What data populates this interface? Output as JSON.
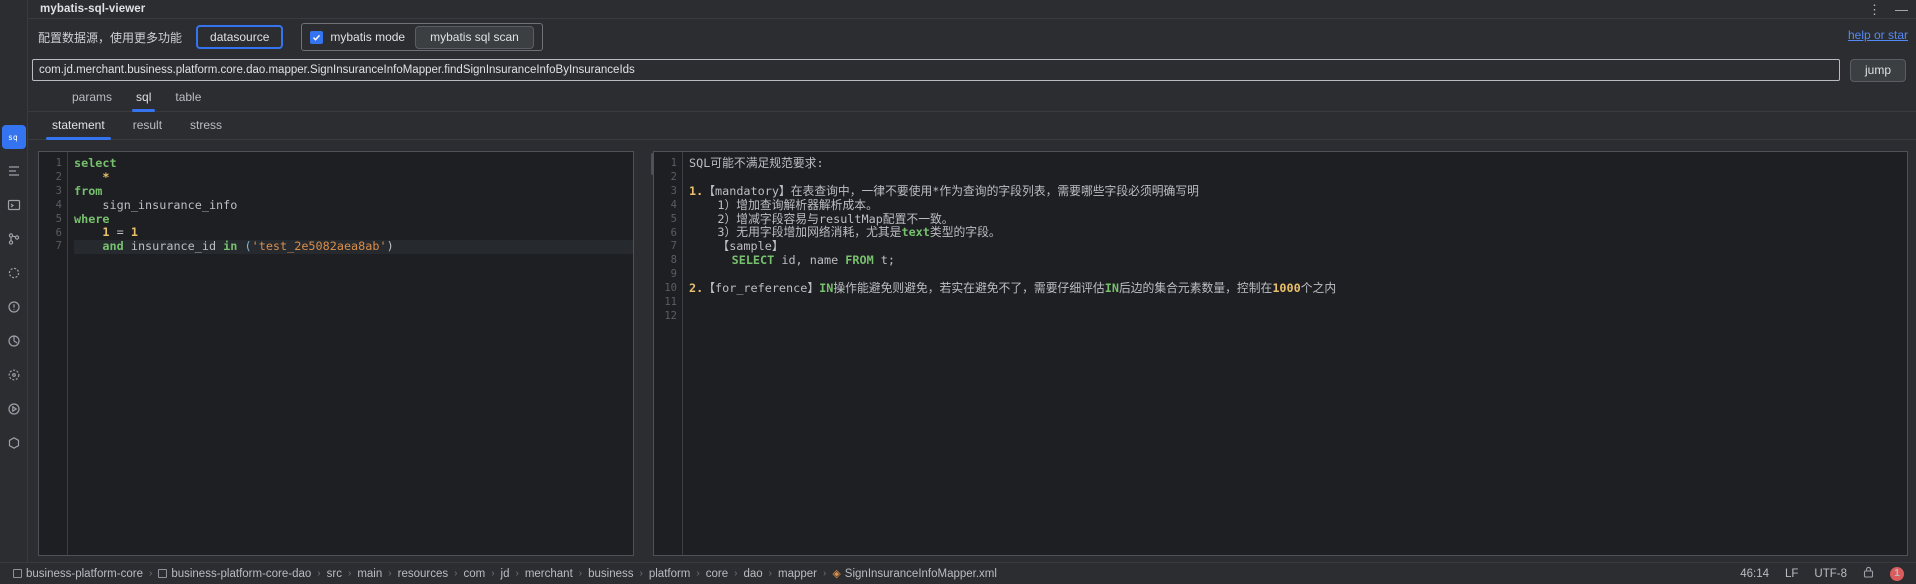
{
  "window": {
    "title": "mybatis-sql-viewer",
    "more_icon": "more-vertical-icon",
    "minimize_icon": "minimize-icon"
  },
  "toolbar": {
    "hint": "配置数据源，使用更多功能",
    "datasource_button": "datasource",
    "mybatis_mode_label": "mybatis mode",
    "mybatis_mode_checked": true,
    "mybatis_sql_scan_button": "mybatis sql scan",
    "help_link": "help or star"
  },
  "search": {
    "value": "com.jd.merchant.business.platform.core.dao.mapper.SignInsuranceInfoMapper.findSignInsuranceInfoByInsuranceIds",
    "placeholder": "",
    "jump_button": "jump"
  },
  "main_tabs": [
    {
      "label": "params",
      "active": false
    },
    {
      "label": "sql",
      "active": true
    },
    {
      "label": "table",
      "active": false
    }
  ],
  "sub_tabs": [
    {
      "label": "statement",
      "active": true
    },
    {
      "label": "result",
      "active": false
    },
    {
      "label": "stress",
      "active": false
    }
  ],
  "rail_icons": [
    {
      "name": "sql-icon",
      "glyph": "sq",
      "active": true
    },
    {
      "name": "structure-icon",
      "glyph": "⫴",
      "active": false
    },
    {
      "name": "terminal-icon",
      "glyph": "▣",
      "active": false
    },
    {
      "name": "branch-icon",
      "glyph": "⑂",
      "active": false
    },
    {
      "name": "debug-icon",
      "glyph": "⬡",
      "active": false
    },
    {
      "name": "problems-icon",
      "glyph": "!",
      "active": false
    },
    {
      "name": "profiler-icon",
      "glyph": "◔",
      "active": false
    },
    {
      "name": "services-icon",
      "glyph": "⬢",
      "active": false
    },
    {
      "name": "run-icon",
      "glyph": "▷",
      "active": false
    },
    {
      "name": "plugins-icon",
      "glyph": "⬣",
      "active": false
    }
  ],
  "sql_editor": {
    "line_numbers": [
      "1",
      "2",
      "3",
      "4",
      "5",
      "6",
      "7"
    ],
    "lines": [
      [
        {
          "t": "select",
          "c": "kw"
        }
      ],
      [
        {
          "t": "    ",
          "c": "plain"
        },
        {
          "t": "*",
          "c": "num"
        }
      ],
      [
        {
          "t": "from",
          "c": "kw"
        }
      ],
      [
        {
          "t": "    sign_insurance_info",
          "c": "plain"
        }
      ],
      [
        {
          "t": "where",
          "c": "kw"
        }
      ],
      [
        {
          "t": "    ",
          "c": "plain"
        },
        {
          "t": "1",
          "c": "num"
        },
        {
          "t": " = ",
          "c": "plain"
        },
        {
          "t": "1",
          "c": "num"
        }
      ],
      [
        {
          "t": "    ",
          "c": "plain"
        },
        {
          "t": "and",
          "c": "kw"
        },
        {
          "t": " insurance_id ",
          "c": "plain"
        },
        {
          "t": "in",
          "c": "kw"
        },
        {
          "t": " ",
          "c": "plain"
        },
        {
          "t": "(",
          "c": "punct"
        },
        {
          "t": "'test_2e5082aea8ab'",
          "c": "str"
        },
        {
          "t": ")",
          "c": "plain"
        }
      ]
    ],
    "highlight_line": 7
  },
  "review_panel": {
    "line_numbers": [
      "1",
      "2",
      "3",
      "4",
      "5",
      "6",
      "7",
      "8",
      "9",
      "10",
      "11",
      "12"
    ],
    "lines": [
      [
        {
          "t": "SQL可能不满足规范要求:",
          "c": "b-txt"
        }
      ],
      [],
      [
        {
          "t": "1.",
          "c": "b-num"
        },
        {
          "t": "【mandatory】在表查询中，一律不要使用*作为查询的字段列表，需要哪些字段必须明确写明",
          "c": "b-txt"
        }
      ],
      [
        {
          "t": "    1）增加查询解析器解析成本。",
          "c": "b-txt"
        }
      ],
      [
        {
          "t": "    2）增减字段容易与resultMap配置不一致。",
          "c": "b-txt"
        }
      ],
      [
        {
          "t": "    3）无用字段增加网络消耗，尤其是",
          "c": "b-txt"
        },
        {
          "t": "text",
          "c": "b-kw"
        },
        {
          "t": "类型的字段。",
          "c": "b-txt"
        }
      ],
      [
        {
          "t": "    【sample】",
          "c": "b-txt"
        }
      ],
      [
        {
          "t": "      ",
          "c": "b-txt"
        },
        {
          "t": "SELECT",
          "c": "b-kw"
        },
        {
          "t": " id, name ",
          "c": "b-txt"
        },
        {
          "t": "FROM",
          "c": "b-kw"
        },
        {
          "t": " t;",
          "c": "b-txt"
        }
      ],
      [],
      [
        {
          "t": "2.",
          "c": "b-num"
        },
        {
          "t": "【for_reference】",
          "c": "b-txt"
        },
        {
          "t": "IN",
          "c": "b-kw"
        },
        {
          "t": "操作能避免则避免，若实在避免不了，需要仔细评估",
          "c": "b-txt"
        },
        {
          "t": "IN",
          "c": "b-kw"
        },
        {
          "t": "后边的集合元素数量，控制在",
          "c": "b-txt"
        },
        {
          "t": "1000",
          "c": "b-num"
        },
        {
          "t": "个之内",
          "c": "b-txt"
        }
      ],
      [],
      []
    ]
  },
  "statusbar": {
    "breadcrumbs": [
      {
        "label": "business-platform-core",
        "icon": "module-icon"
      },
      {
        "label": "business-platform-core-dao",
        "icon": "module-icon"
      },
      {
        "label": "src",
        "icon": null
      },
      {
        "label": "main",
        "icon": null
      },
      {
        "label": "resources",
        "icon": null
      },
      {
        "label": "com",
        "icon": null
      },
      {
        "label": "jd",
        "icon": null
      },
      {
        "label": "merchant",
        "icon": null
      },
      {
        "label": "business",
        "icon": null
      },
      {
        "label": "platform",
        "icon": null
      },
      {
        "label": "core",
        "icon": null
      },
      {
        "label": "dao",
        "icon": null
      },
      {
        "label": "mapper",
        "icon": null
      },
      {
        "label": "SignInsuranceInfoMapper.xml",
        "icon": "xml-file-icon"
      }
    ],
    "separator": "›",
    "caret_position": "46:14",
    "line_separator": "LF",
    "encoding": "UTF-8",
    "lock_icon": "lock-icon",
    "warning_count": "1"
  },
  "colors": {
    "accent": "#3574f0",
    "link": "#548af7",
    "editor_bg": "#1e1f22",
    "panel_bg": "#2b2d30",
    "keyword": "#77c06e",
    "number": "#e8bf6a",
    "string": "#d98e4b",
    "warning": "#db5c5c"
  }
}
